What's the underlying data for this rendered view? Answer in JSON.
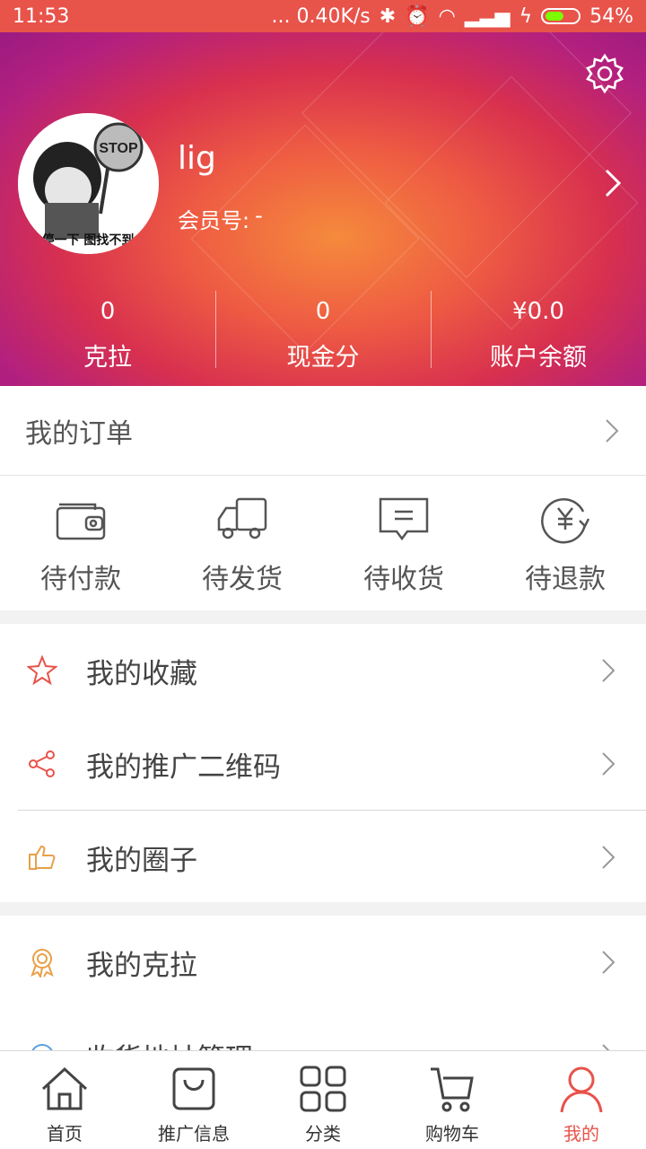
{
  "status_bar": {
    "time": "11:53",
    "network_speed": "... 0.40K/s",
    "battery": "54%"
  },
  "profile": {
    "username": "lig",
    "member_label": "会员号:",
    "member_value": "-",
    "avatar_caption": "停一下 图找不到",
    "avatar_sign": "STOP"
  },
  "stats": [
    {
      "value": "0",
      "label": "克拉"
    },
    {
      "value": "0",
      "label": "现金分"
    },
    {
      "value": "¥0.0",
      "label": "账户余额"
    }
  ],
  "orders": {
    "title": "我的订单",
    "items": [
      {
        "label": "待付款",
        "icon": "wallet-icon"
      },
      {
        "label": "待发货",
        "icon": "truck-icon"
      },
      {
        "label": "待收货",
        "icon": "message-icon"
      },
      {
        "label": "待退款",
        "icon": "refund-icon"
      }
    ]
  },
  "menu": [
    {
      "label": "我的收藏",
      "icon": "star-icon"
    },
    {
      "label": "我的推广二维码",
      "icon": "share-icon"
    },
    {
      "label": "我的圈子",
      "icon": "thumbs-up-icon"
    },
    {
      "label": "我的克拉",
      "icon": "award-icon"
    },
    {
      "label": "收货地址管理",
      "icon": "location-icon"
    }
  ],
  "tabbar": [
    {
      "label": "首页",
      "icon": "home-icon"
    },
    {
      "label": "推广信息",
      "icon": "bag-icon"
    },
    {
      "label": "分类",
      "icon": "grid-icon"
    },
    {
      "label": "购物车",
      "icon": "cart-icon"
    },
    {
      "label": "我的",
      "icon": "user-icon",
      "active": true
    }
  ],
  "colors": {
    "accent": "#e8534a",
    "icon_gray": "#666666",
    "icon_orange": "#e8a04a"
  }
}
